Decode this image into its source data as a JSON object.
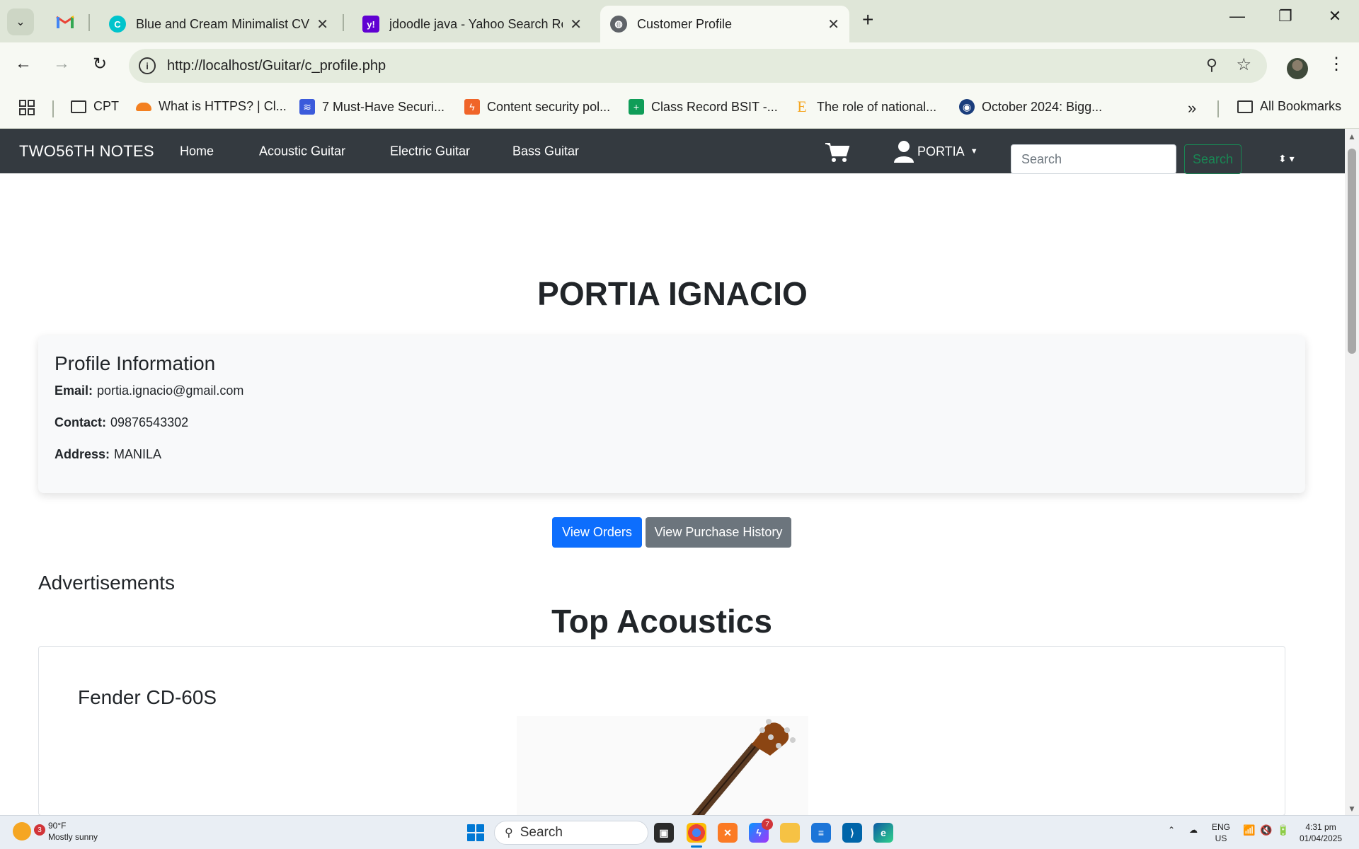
{
  "browser": {
    "tabs": [
      {
        "title": "Blue and Cream Minimalist CV R",
        "favicon": "canva-icon",
        "color": "#00c4cc"
      },
      {
        "title": "jdoodle java - Yahoo Search Res",
        "favicon": "yahoo-icon",
        "color": "#6001d2"
      },
      {
        "title": "Customer Profile",
        "favicon": "globe-icon",
        "color": "#5f6368"
      }
    ],
    "url": "http://localhost/Guitar/c_profile.php",
    "bookmarks": [
      {
        "label": "CPT",
        "icon": "folder-icon"
      },
      {
        "label": "What is HTTPS? | Cl...",
        "icon": "cloudflare-icon",
        "color": "#f38020"
      },
      {
        "label": "7 Must-Have Securi...",
        "icon": "layers-icon",
        "color": "#3b5bdb"
      },
      {
        "label": "Content security pol...",
        "icon": "bolt-icon",
        "color": "#f06529"
      },
      {
        "label": "Class Record BSIT -...",
        "icon": "sheets-icon",
        "color": "#0f9d58"
      },
      {
        "label": "The role of national...",
        "icon": "e-letter-icon",
        "color": "#f5a623"
      },
      {
        "label": "October 2024: Bigg...",
        "icon": "circle-logo-icon",
        "color": "#1a3d7c"
      }
    ],
    "all_bookmarks": "All Bookmarks"
  },
  "site": {
    "brand": "TWO56TH NOTES",
    "nav": [
      "Home",
      "Acoustic Guitar",
      "Electric Guitar",
      "Bass Guitar"
    ],
    "user": "PORTIA",
    "search_placeholder": "Search",
    "search_button": "Search"
  },
  "profile": {
    "name": "PORTIA IGNACIO",
    "section_title": "Profile Information",
    "email_label": "Email:",
    "email": "portia.ignacio@gmail.com",
    "contact_label": "Contact:",
    "contact": "09876543302",
    "address_label": "Address:",
    "address": "MANILA"
  },
  "actions": {
    "view_orders": "View Orders",
    "view_history": "View Purchase History"
  },
  "ads": {
    "title": "Advertisements",
    "heading": "Top Acoustics",
    "product": "Fender CD-60S"
  },
  "taskbar": {
    "temp": "90°F",
    "weather": "Mostly sunny",
    "weather_badge": "3",
    "search": "Search",
    "messenger_badge": "7",
    "lang": "ENG",
    "region": "US",
    "time": "4:31 pm",
    "date": "01/04/2025"
  },
  "colors": {
    "navbar": "#343a40",
    "primary": "#0d6efd",
    "secondary": "#6c757d",
    "success": "#198754"
  }
}
